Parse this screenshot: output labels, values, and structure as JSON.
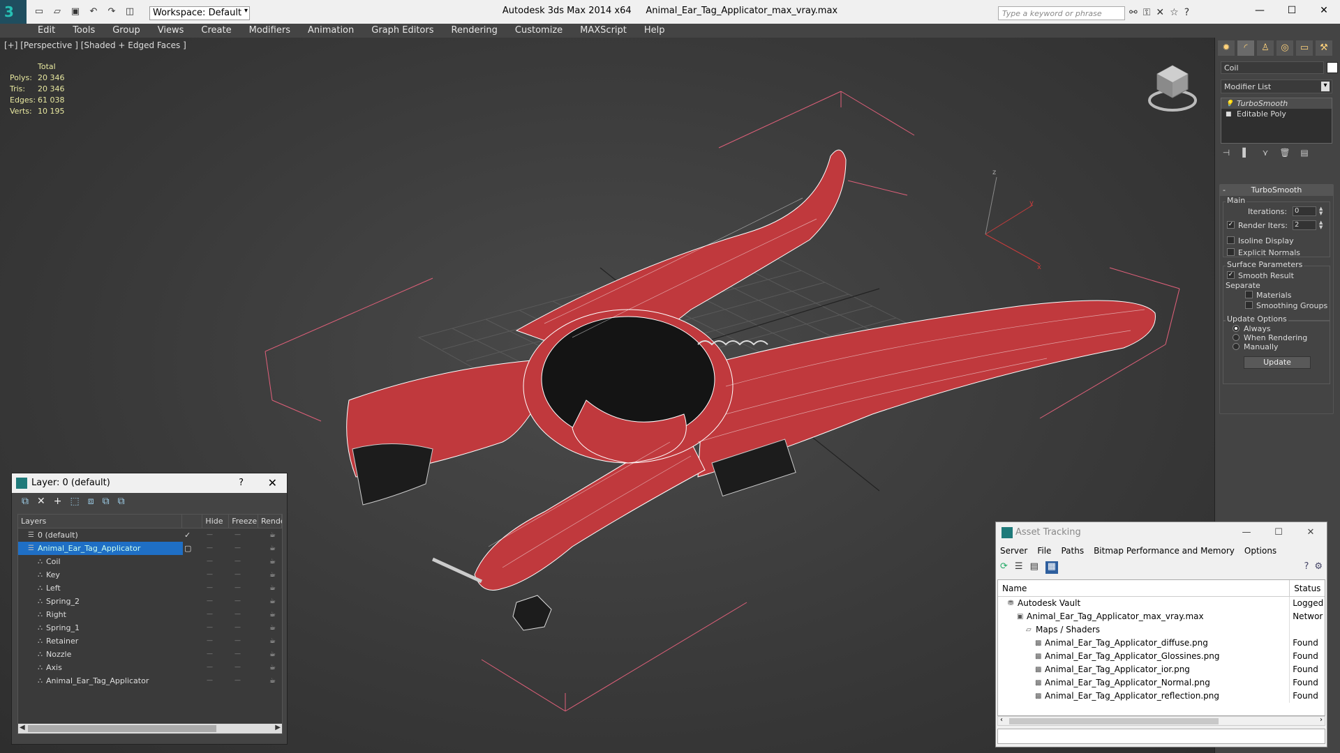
{
  "app": {
    "title": "Autodesk 3ds Max  2014 x64",
    "file": "Animal_Ear_Tag_Applicator_max_vray.max",
    "logo_letter": "3",
    "workspace": "Workspace: Default",
    "search_placeholder": "Type a keyword or phrase"
  },
  "menubar": [
    "Edit",
    "Tools",
    "Group",
    "Views",
    "Create",
    "Modifiers",
    "Animation",
    "Graph Editors",
    "Rendering",
    "Customize",
    "MAXScript",
    "Help"
  ],
  "viewport": {
    "label": "[+] [Perspective ] [Shaded + Edged Faces ]",
    "stats": {
      "header": "Total",
      "rows": [
        {
          "key": "Polys:",
          "value": "20 346"
        },
        {
          "key": "Tris:",
          "value": "20 346"
        },
        {
          "key": "Edges:",
          "value": "61 038"
        },
        {
          "key": "Verts:",
          "value": "10 195"
        }
      ]
    },
    "axis": {
      "x": "x",
      "y": "y",
      "z": "z"
    },
    "model_color": "#c0393d"
  },
  "command_panel": {
    "object_name": "Coil",
    "modifier_list": "Modifier List",
    "stack": [
      "TurboSmooth",
      "Editable Poly"
    ],
    "turbosmooth": {
      "title": "TurboSmooth",
      "main_label": "Main",
      "iterations_label": "Iterations:",
      "iterations_value": "0",
      "render_iters_label": "Render Iters:",
      "render_iters_value": "2",
      "isoline_label": "Isoline Display",
      "explicit_normals_label": "Explicit Normals",
      "surface_params_label": "Surface Parameters",
      "smooth_result_label": "Smooth Result",
      "separate_label": "Separate",
      "materials_label": "Materials",
      "smoothing_groups_label": "Smoothing Groups",
      "update_options_label": "Update Options",
      "always_label": "Always",
      "when_rendering_label": "When Rendering",
      "manually_label": "Manually",
      "update_button": "Update"
    }
  },
  "layer_window": {
    "title": "Layer: 0 (default)",
    "help": "?",
    "columns": [
      "Layers",
      "Hide",
      "Freeze",
      "Rende"
    ],
    "rows": [
      {
        "name": "0 (default)",
        "indent": 1,
        "checked": "✓"
      },
      {
        "name": "Animal_Ear_Tag_Applicator",
        "indent": 1,
        "selected": true
      },
      {
        "name": "Coil",
        "indent": 2
      },
      {
        "name": "Key",
        "indent": 2
      },
      {
        "name": "Left",
        "indent": 2
      },
      {
        "name": "Spring_2",
        "indent": 2
      },
      {
        "name": "Right",
        "indent": 2
      },
      {
        "name": "Spring_1",
        "indent": 2
      },
      {
        "name": "Retainer",
        "indent": 2
      },
      {
        "name": "Nozzle",
        "indent": 2
      },
      {
        "name": "Axis",
        "indent": 2
      },
      {
        "name": "Animal_Ear_Tag_Applicator",
        "indent": 2
      }
    ]
  },
  "asset_tracking": {
    "title": "Asset Tracking",
    "menu": [
      "Server",
      "File",
      "Paths",
      "Bitmap Performance and Memory",
      "Options"
    ],
    "columns": [
      "Name",
      "Status"
    ],
    "rows": [
      {
        "name": "Autodesk Vault",
        "status": "Logged",
        "indent": 1
      },
      {
        "name": "Animal_Ear_Tag_Applicator_max_vray.max",
        "status": "Networ",
        "indent": 2
      },
      {
        "name": "Maps / Shaders",
        "status": "",
        "indent": 3
      },
      {
        "name": "Animal_Ear_Tag_Applicator_diffuse.png",
        "status": "Found",
        "indent": 4
      },
      {
        "name": "Animal_Ear_Tag_Applicator_Glossines.png",
        "status": "Found",
        "indent": 4
      },
      {
        "name": "Animal_Ear_Tag_Applicator_ior.png",
        "status": "Found",
        "indent": 4
      },
      {
        "name": "Animal_Ear_Tag_Applicator_Normal.png",
        "status": "Found",
        "indent": 4
      },
      {
        "name": "Animal_Ear_Tag_Applicator_reflection.png",
        "status": "Found",
        "indent": 4
      }
    ]
  }
}
